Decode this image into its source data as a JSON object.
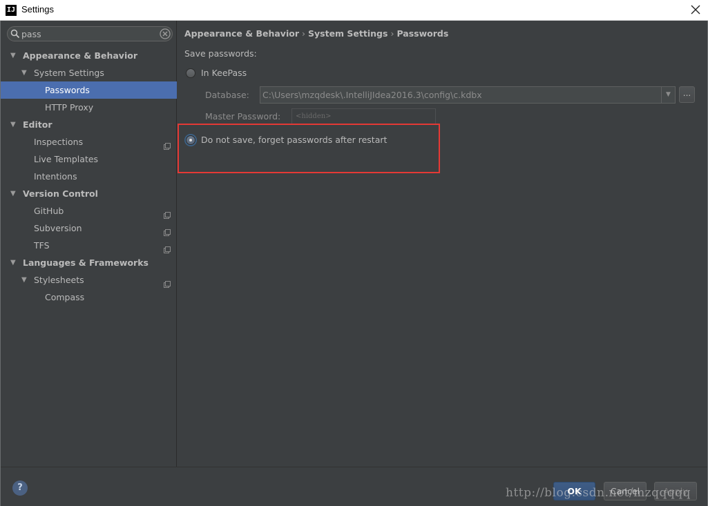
{
  "window": {
    "title": "Settings",
    "app_icon_text": "IJ"
  },
  "search": {
    "value": "pass"
  },
  "tree": [
    {
      "label": "Appearance & Behavior",
      "expanded": true
    },
    {
      "label": "System Settings",
      "expanded": true
    },
    {
      "label": "Passwords",
      "selected": true
    },
    {
      "label": "HTTP Proxy"
    },
    {
      "label": "Editor",
      "expanded": true
    },
    {
      "label": "Inspections",
      "project_level": true
    },
    {
      "label": "Live Templates"
    },
    {
      "label": "Intentions"
    },
    {
      "label": "Version Control",
      "expanded": true
    },
    {
      "label": "GitHub",
      "project_level": true
    },
    {
      "label": "Subversion",
      "project_level": true
    },
    {
      "label": "TFS",
      "project_level": true
    },
    {
      "label": "Languages & Frameworks",
      "expanded": true
    },
    {
      "label": "Stylesheets",
      "expanded": true,
      "project_level": true
    },
    {
      "label": "Compass"
    }
  ],
  "breadcrumb": [
    "Appearance & Behavior",
    "System Settings",
    "Passwords"
  ],
  "passwords": {
    "save_label": "Save passwords:",
    "keepass_label": "In KeePass",
    "keepass_selected": false,
    "database_label": "Database:",
    "database_value": "C:\\Users\\mzqdesk\\.IntelliJIdea2016.3\\config\\c.kdbx",
    "browse_label": "...",
    "master_label": "Master Password:",
    "master_placeholder": "<hidden>",
    "donotsave_label": "Do not save, forget passwords after restart",
    "donotsave_selected": true
  },
  "footer": {
    "help_label": "?",
    "ok_label": "OK",
    "cancel_label": "Cancel",
    "apply_label": "Apply"
  },
  "watermark": "http://blog.csdn.net/mzqqqqq",
  "colors": {
    "background": "#3c3f41",
    "selection": "#4b6eaf",
    "highlight_box": "#e53935",
    "text": "#bbbbbb"
  }
}
